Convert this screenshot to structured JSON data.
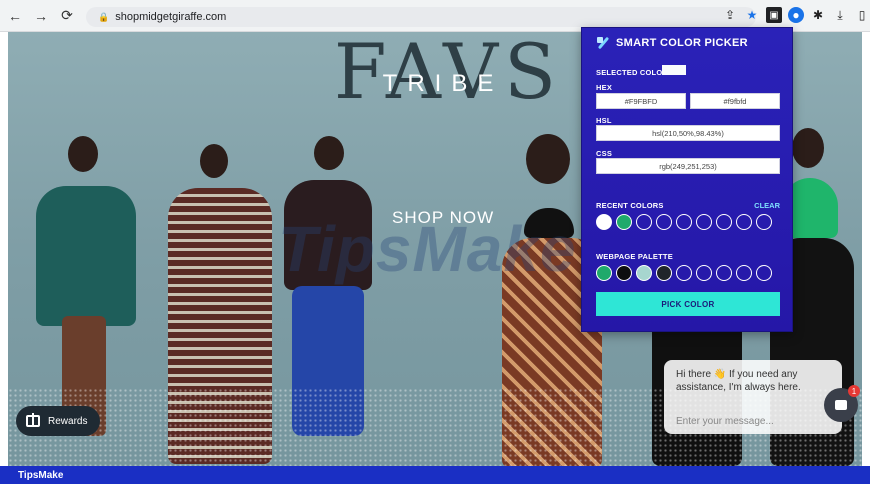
{
  "browser": {
    "url": "shopmidgetgiraffe.com"
  },
  "hero": {
    "logo": "FAVS",
    "subtitle": "TRIBE",
    "cta": "SHOP NOW",
    "watermark": "TipsMake"
  },
  "rewards": {
    "label": "Rewards"
  },
  "chat": {
    "message": "Hi there 👋 If you need any assistance, I'm always here.",
    "input_placeholder": "Enter your message...",
    "badge_count": "1"
  },
  "picker": {
    "title": "SMART COLOR PICKER",
    "selected_color_label": "SELECTED COLOR",
    "selected_color_swatch": "#F9FBFD",
    "hex_label": "HEX",
    "hex_upper": "#F9FBFD",
    "hex_lower": "#f9fbfd",
    "hsl_label": "HSL",
    "hsl_value": "hsl(210,50%,98.43%)",
    "css_label": "CSS",
    "css_value": "rgb(249,251,253)",
    "recent_label": "RECENT COLORS",
    "clear_label": "CLEAR",
    "recent_colors": [
      "#FFFFFF",
      "#1FA96B"
    ],
    "webpage_label": "WEBPAGE PALETTE",
    "webpage_colors": [
      "#1FA96B",
      "#0E0E10",
      "#A7D6CF",
      "#20252A"
    ],
    "pick_button": "PICK COLOR"
  },
  "footer": {
    "brand": "TipsMake"
  }
}
